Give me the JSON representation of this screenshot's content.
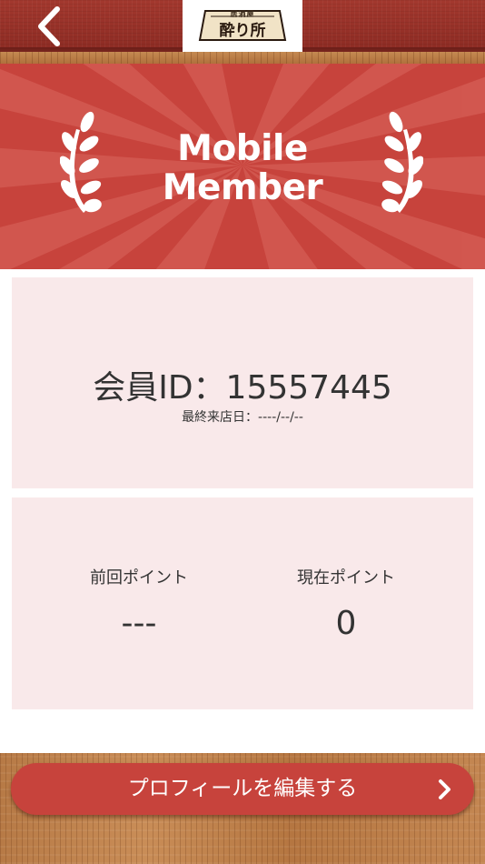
{
  "header": {
    "back_icon": "chevron-left-icon",
    "logo_small_text": "居酒屋",
    "logo_main_text": "酔り所",
    "colors": {
      "bar": "#a3382e",
      "logo_bg": "#ffffff"
    }
  },
  "banner": {
    "title_line1": "Mobile",
    "title_line2": "Member",
    "left_icon": "laurel-left-icon",
    "right_icon": "laurel-right-icon",
    "colors": {
      "background": "#c7433c",
      "rays": "#d66058",
      "text": "#ffffff"
    }
  },
  "member_card": {
    "id_line": "会員ID：15557445",
    "last_visit_line": "最終来店日：----/--/--",
    "background": "#f9e9ea"
  },
  "points_card": {
    "previous": {
      "label": "前回ポイント",
      "value": "---"
    },
    "current": {
      "label": "現在ポイント",
      "value": "0"
    }
  },
  "footer": {
    "edit_profile_label": "プロフィールを編集する",
    "edit_icon": "chevron-right-icon",
    "button_color": "#c7433c"
  }
}
